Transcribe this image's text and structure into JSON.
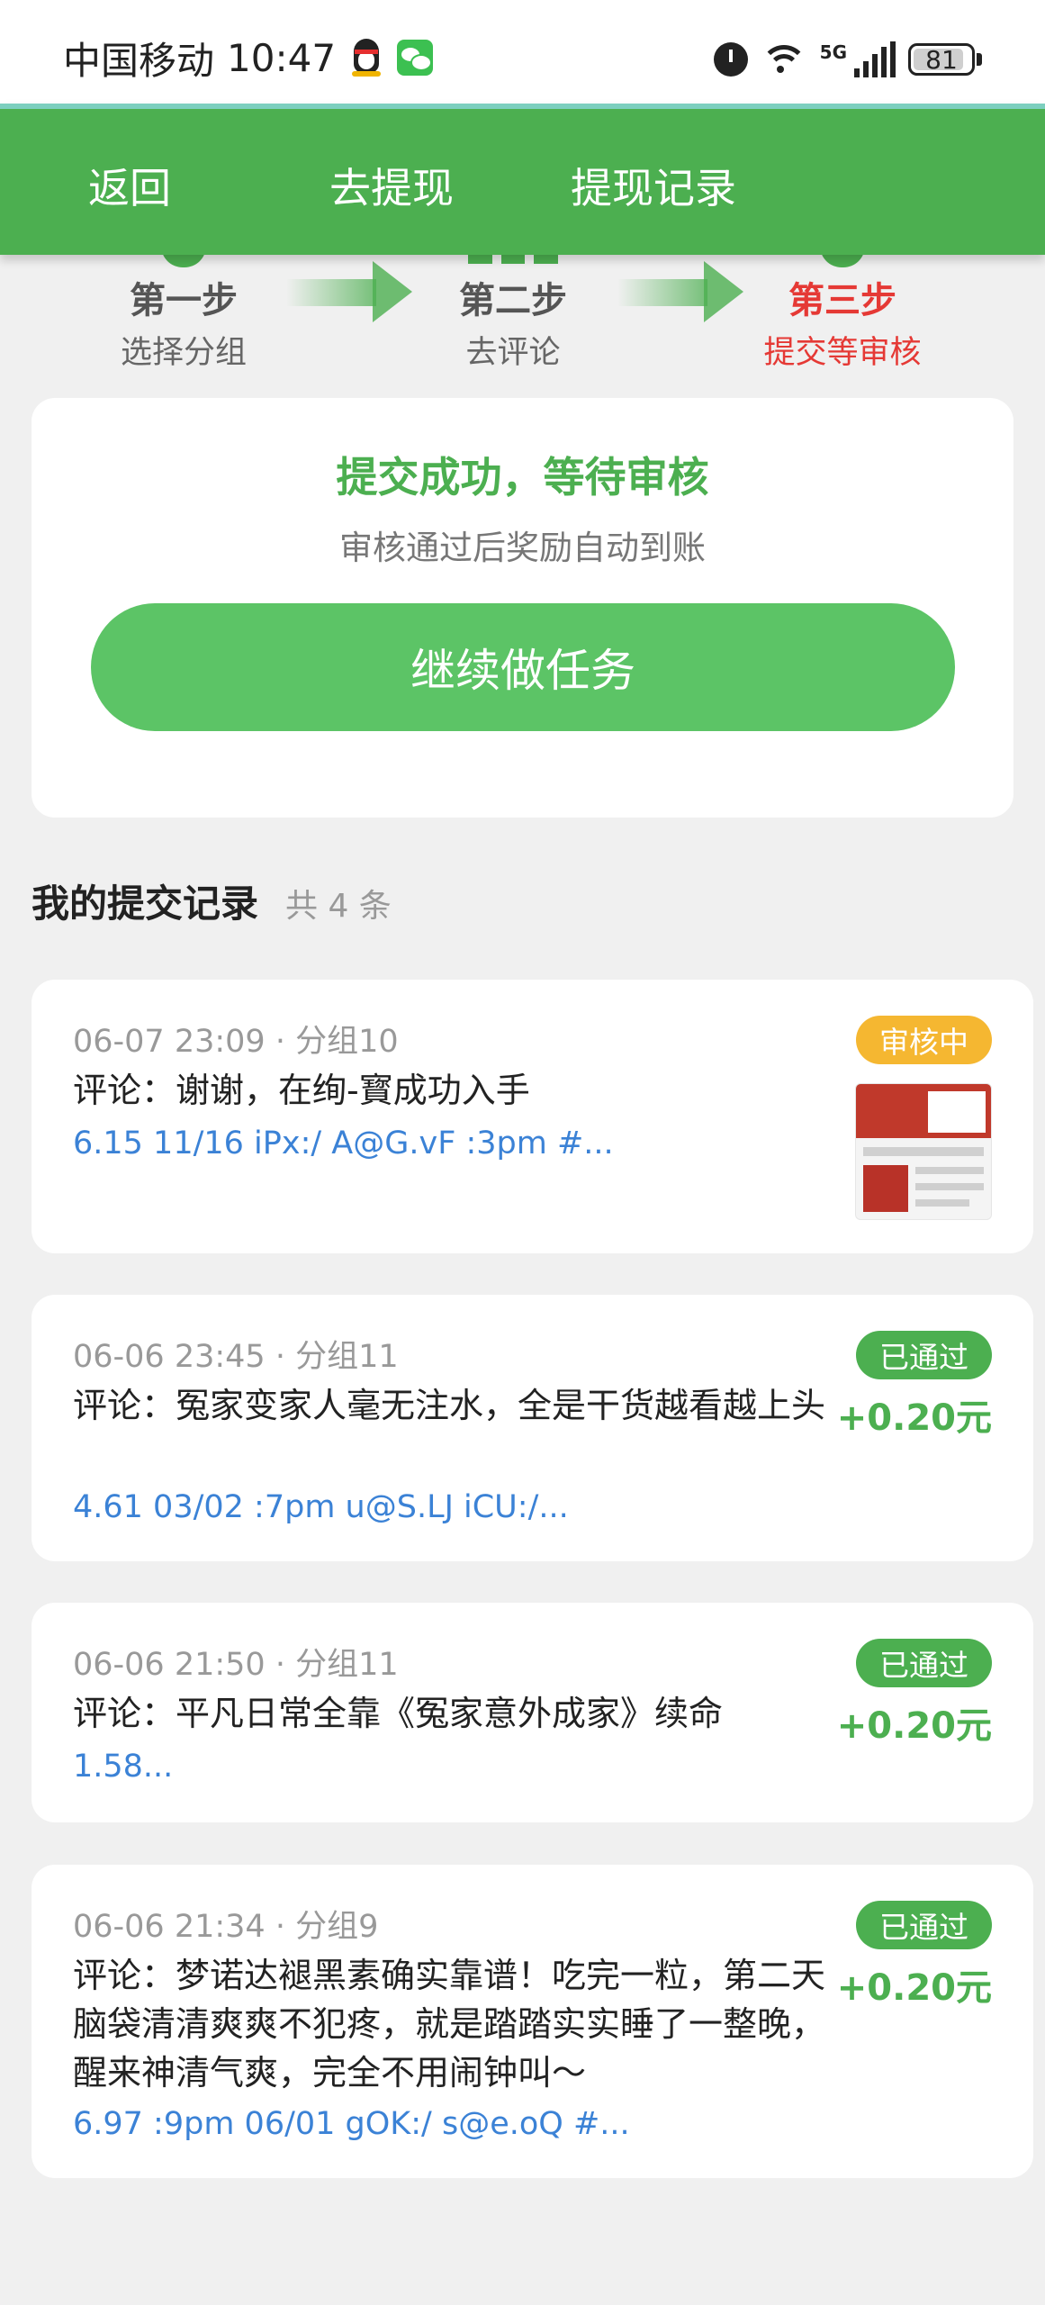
{
  "status_bar": {
    "carrier": "中国移动",
    "time": "10:47",
    "network": "5G",
    "battery": "81"
  },
  "nav": {
    "back": "返回",
    "withdraw": "去提现",
    "records": "提现记录"
  },
  "steps": [
    {
      "title": "第一步",
      "sub": "选择分组"
    },
    {
      "title": "第二步",
      "sub": "去评论"
    },
    {
      "title": "第三步",
      "sub": "提交等审核"
    }
  ],
  "success": {
    "title": "提交成功，等待审核",
    "subtitle": "审核通过后奖励自动到账",
    "button": "继续做任务"
  },
  "records_header": {
    "title": "我的提交记录",
    "count": "共 4 条"
  },
  "records": [
    {
      "meta": "06-07 23:09 · 分组10",
      "comment": "评论：谢谢，在绚-寳成功入手",
      "link": "6.15 11/16 iPx:/ A@G.vF :3pm #...",
      "status": "审核中",
      "amount": ""
    },
    {
      "meta": "06-06 23:45 · 分组11",
      "comment": "评论：冤家变家人毫无注水，全是干货越看越上头",
      "link": "4.61 03/02 :7pm u@S.LJ iCU:/...",
      "status": "已通过",
      "amount": "+0.20元"
    },
    {
      "meta": "06-06 21:50 · 分组11",
      "comment": "评论：平凡日常全靠《冤家意外成家》续命",
      "link": "1.58...",
      "status": "已通过",
      "amount": "+0.20元"
    },
    {
      "meta": "06-06 21:34 · 分组9",
      "comment": "评论：梦诺达褪黑素确实靠谱！吃完一粒，第二天脑袋清清爽爽不犯疼，就是踏踏实实睡了一整晚，醒来神清气爽，完全不用闹钟叫～",
      "link": "6.97 :9pm 06/01 gOK:/ s@e.oQ #...",
      "status": "已通过",
      "amount": "+0.20元"
    }
  ],
  "colors": {
    "primary": "#4caf50",
    "button": "#5cc466",
    "pending": "#f5b731",
    "active_step": "#e53935",
    "link": "#3b82d6"
  }
}
